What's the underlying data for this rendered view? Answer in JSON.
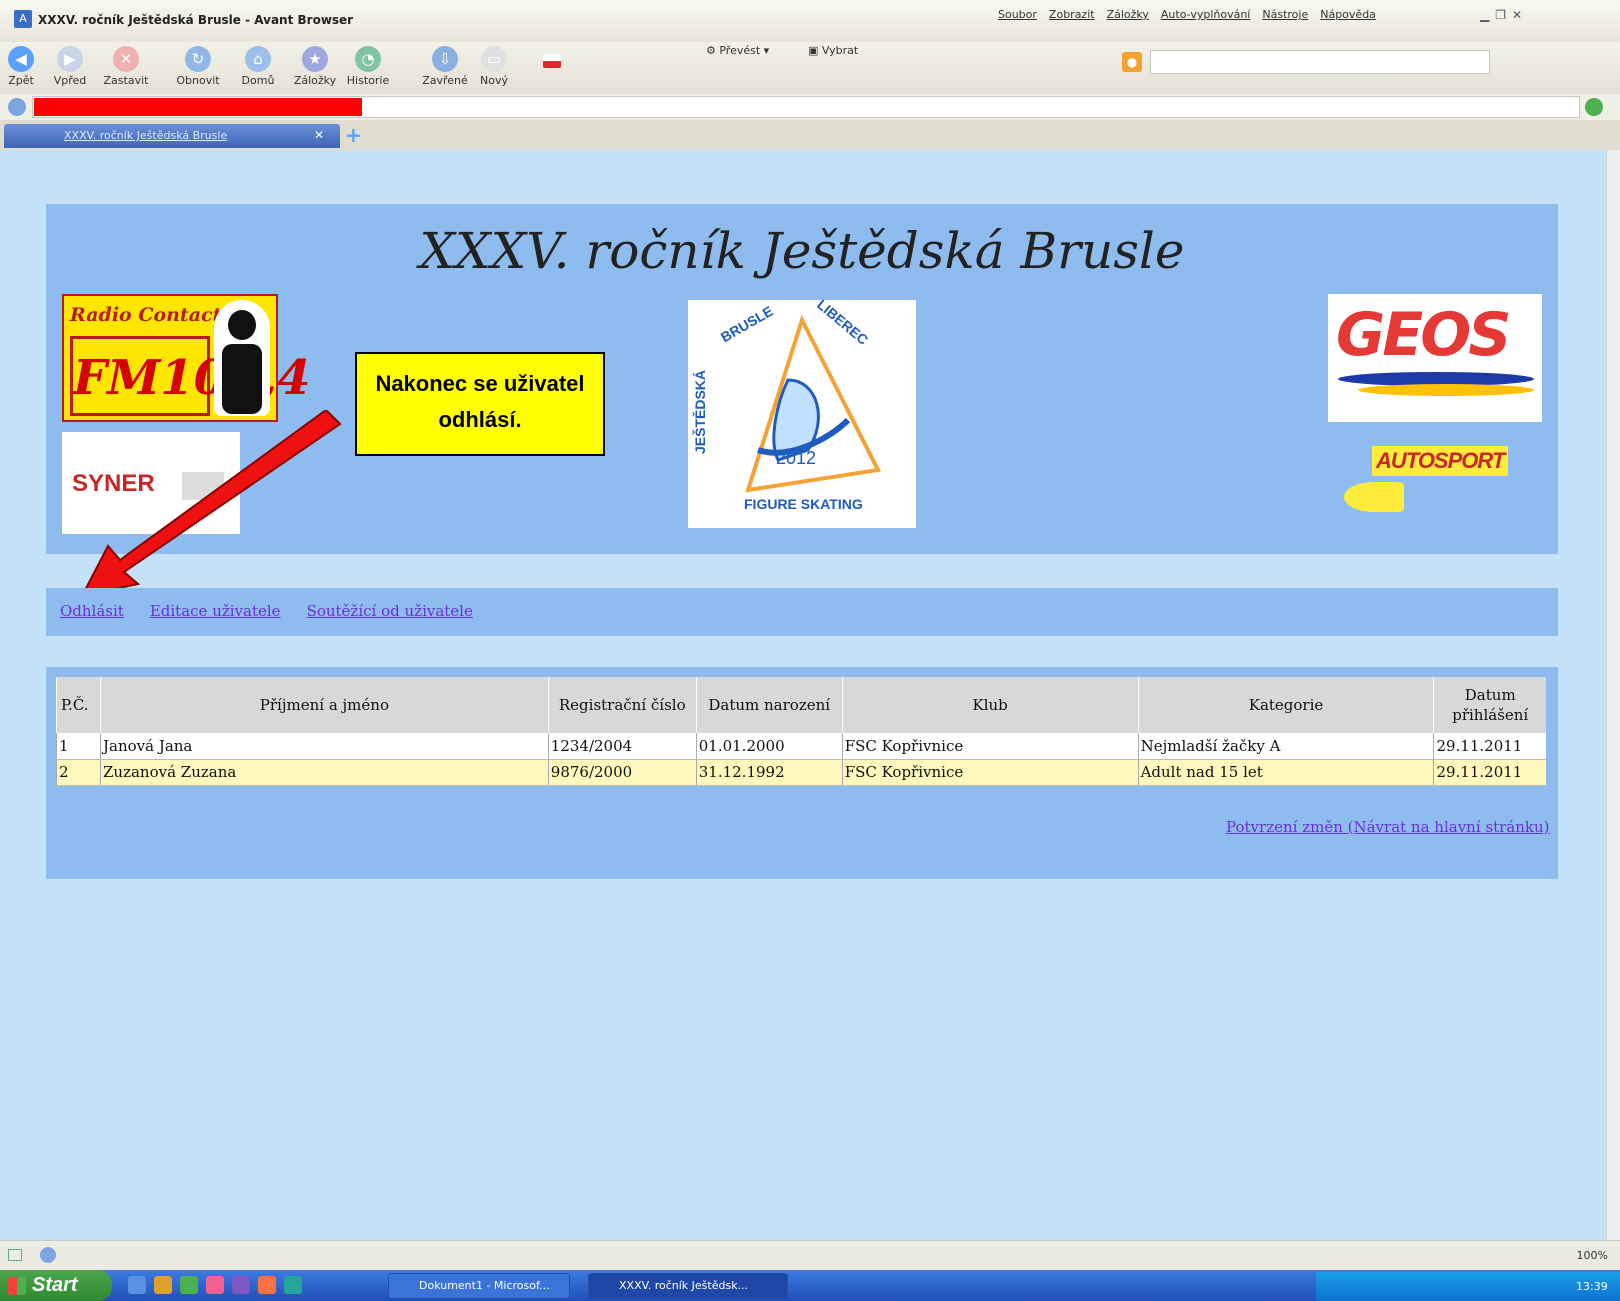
{
  "window": {
    "title": "XXXV. ročník Ještědská Brusle - Avant Browser",
    "menu": [
      "Soubor",
      "Zobrazit",
      "Záložky",
      "Auto-vyplňování",
      "Nástroje",
      "Nápověda"
    ]
  },
  "toolbar": {
    "buttons": [
      "Zpět",
      "Vpřed",
      "Zastavit",
      "Obnovit",
      "Domů",
      "Záložky",
      "Historie",
      "Zavřené",
      "Nový"
    ],
    "prevest": "Převést",
    "vybrat": "Vybrat"
  },
  "tab": {
    "label": "XXXV. ročník Ještědská Brusle"
  },
  "page": {
    "title": "XXXV. ročník Ještědská Brusle",
    "logos": {
      "radio_name": "Radio Contact",
      "radio_freq": "FM101,4",
      "syner": "SYNER",
      "center_top_left": "BRUSLE",
      "center_top_right": "LIBEREC",
      "center_left": "JEŠTĚDSKÁ",
      "center_bottom": "FIGURE SKATING",
      "center_year": "2012",
      "geos": "GEOS",
      "autosport": "AUTOSPORT"
    },
    "callout": "Nakonec se uživatel odhlásí.",
    "nav": {
      "logout": "Odhlásit",
      "edit_user": "Editace uživatele",
      "competitors": "Soutěžící od uživatele"
    },
    "table": {
      "headers": [
        "P.Č.",
        "Příjmení a jméno",
        "Registrační číslo",
        "Datum narození",
        "Klub",
        "Kategorie",
        "Datum přihlášení"
      ],
      "rows": [
        [
          "1",
          "Janová Jana",
          "1234/2004",
          "01.01.2000",
          "FSC Kopřivnice",
          "Nejmladší žačky A",
          "29.11.2011"
        ],
        [
          "2",
          "Zuzanová Zuzana",
          "9876/2000",
          "31.12.1992",
          "FSC Kopřivnice",
          "Adult nad 15 let",
          "29.11.2011"
        ]
      ]
    },
    "confirm_link": "Potvrzení změn (Návrat na hlavní stránku)"
  },
  "statusbar": {
    "zoom": "100%"
  },
  "taskbar": {
    "start": "Start",
    "items": [
      "Dokument1 - Microsof...",
      "XXXV. ročník Ještědsk..."
    ],
    "clock": "13:39"
  },
  "colors": {
    "page_bg": "#c4e2f7",
    "panel_bg": "#8ebcee",
    "link": "#6a2fd6",
    "callout": "#ffff00",
    "arrow": "#ee1111",
    "highlight_row": "#fff8bc"
  }
}
